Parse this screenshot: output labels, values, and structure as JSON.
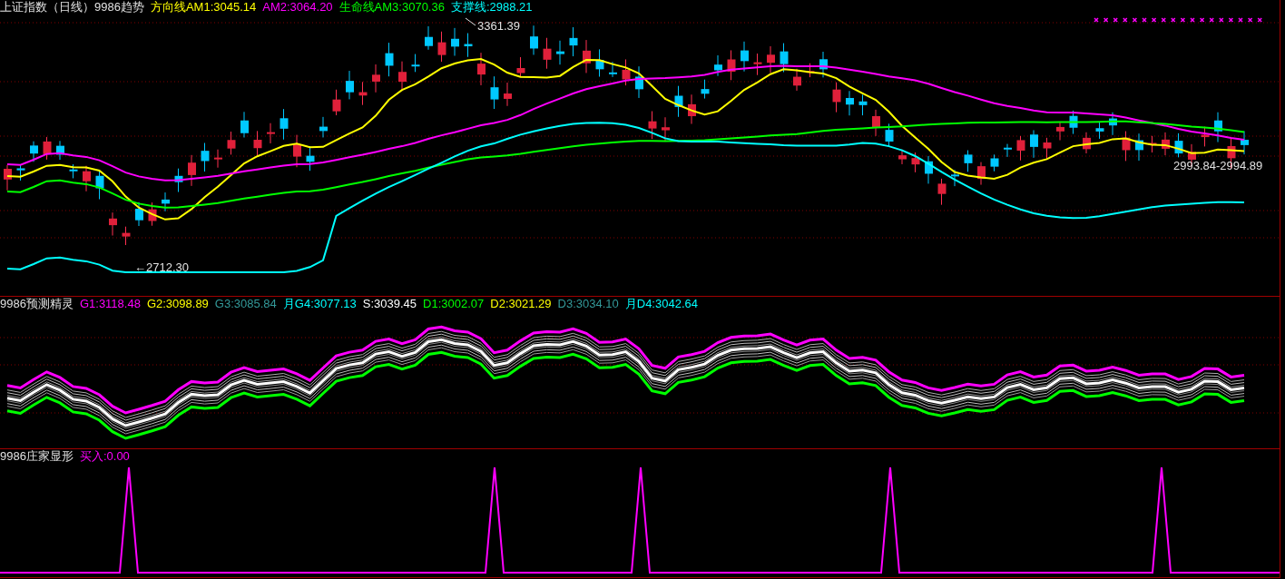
{
  "panels": [
    {
      "kind": "price",
      "title": "上证指数（日线）9986趋势",
      "legend": [
        {
          "label": "方向线AM1:3045.14",
          "color": "#ffff00"
        },
        {
          "label": "AM2:3064.20",
          "color": "#ff00ff"
        },
        {
          "label": "生命线AM3:3070.36",
          "color": "#00ff00"
        },
        {
          "label": "支撑线:2988.21",
          "color": "#00ffff"
        }
      ],
      "annotations": [
        "3361.39",
        "←2712.30",
        "2993.84-2994.89"
      ]
    },
    {
      "kind": "bands",
      "title": "9986预测精灵",
      "legend": [
        {
          "label": "G1:3118.48",
          "color": "#ff00ff"
        },
        {
          "label": "G2:3098.89",
          "color": "#ffff00"
        },
        {
          "label": "G3:3085.84",
          "color": "#339999"
        },
        {
          "label": "月G4:3077.13",
          "color": "#00ffff"
        },
        {
          "label": "S:3039.45",
          "color": "#ffffff"
        },
        {
          "label": "D1:3002.07",
          "color": "#00ff00"
        },
        {
          "label": "D2:3021.29",
          "color": "#ffff00"
        },
        {
          "label": "D3:3034.10",
          "color": "#339999"
        },
        {
          "label": "月D4:3042.64",
          "color": "#00ffff"
        }
      ]
    },
    {
      "kind": "signal",
      "title": "9986庄家显形",
      "legend": [
        {
          "label": "买入:0.00",
          "color": "#ff00ff"
        }
      ]
    }
  ]
}
